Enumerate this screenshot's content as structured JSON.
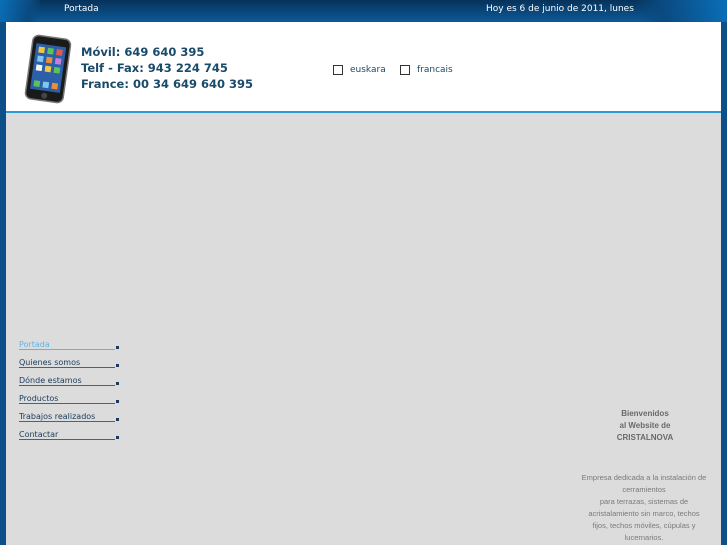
{
  "topbar": {
    "crumb": "Portada",
    "date": "Hoy es 6 de junio de 2011, lunes"
  },
  "header": {
    "movil": "Móvil: 649 640 395",
    "telf": "Telf - Fax: 943 224 745",
    "france": "France: 00 34 649 640 395",
    "languages": [
      "euskara",
      "francais"
    ]
  },
  "nav": {
    "items": [
      {
        "label": "Portada",
        "active": true
      },
      {
        "label": "Quienes somos"
      },
      {
        "label": "Dónde estamos"
      },
      {
        "label": "Productos"
      },
      {
        "label": "Trabajos realizados"
      },
      {
        "label": "Contactar"
      }
    ]
  },
  "welcome": {
    "line1": "Bienvenidos",
    "line2": "al Website de",
    "line3": "CRISTALNOVA"
  },
  "description": {
    "line1": "Empresa dedicada a la instalación de cerramientos",
    "line2": "para terrazas, sistemas de acristalamiento sin marco, techos",
    "line3": "fijos, techos móviles, cúpulas y lucernarios."
  },
  "colors": {
    "accent": "#2c9ad6",
    "topbar": "#0a4a80",
    "active_nav": "#5fb3e6"
  }
}
